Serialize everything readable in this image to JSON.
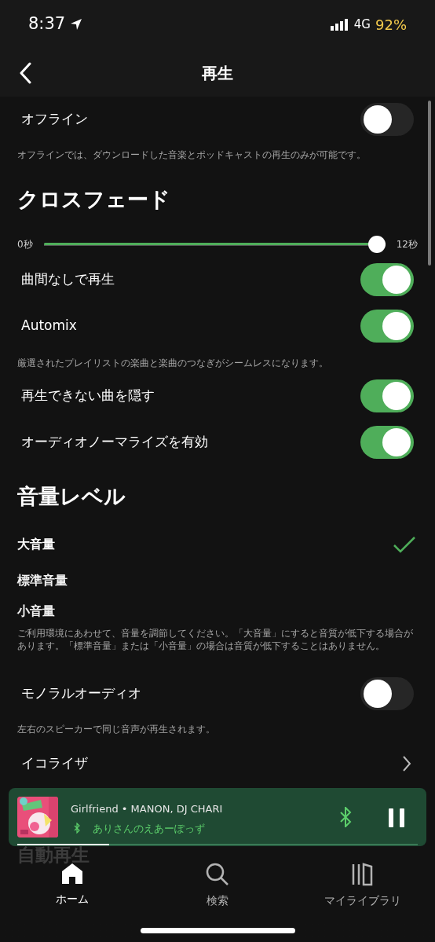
{
  "status_bar": {
    "time": "8:37",
    "network": "4G",
    "battery": "92%"
  },
  "nav": {
    "title": "再生"
  },
  "settings": [
    {
      "kind": "toggle",
      "label": "オフライン",
      "on": false
    },
    {
      "kind": "description",
      "text": "オフラインでは、ダウンロードした音楽とポッドキャストの再生のみが可能です。"
    },
    {
      "kind": "heading",
      "text": "クロスフェード"
    },
    {
      "kind": "slider",
      "min_label": "0秒",
      "max_label": "12秒",
      "level": 1
    },
    {
      "kind": "toggle",
      "label": "曲間なしで再生",
      "on": true
    },
    {
      "kind": "toggle",
      "label": "Automix",
      "on": true
    },
    {
      "kind": "description",
      "text": "厳選されたプレイリストの楽曲と楽曲のつなぎがシームレスになります。"
    },
    {
      "kind": "toggle",
      "label": "再生できない曲を隠す",
      "on": true
    },
    {
      "kind": "toggle",
      "label": "オーディオノーマライズを有効",
      "on": true
    },
    {
      "kind": "heading",
      "text": "音量レベル"
    },
    {
      "kind": "option",
      "label": "大音量",
      "selected": true
    },
    {
      "kind": "option",
      "label": "標準音量",
      "selected": false
    },
    {
      "kind": "option",
      "label": "小音量",
      "selected": false
    },
    {
      "kind": "description",
      "text": "ご利用環境にあわせて、音量を調節してください。「大音量」にすると音質が低下する場合があります。「標準音量」または「小音量」の場合は音質が低下することはありません。"
    },
    {
      "kind": "toggle",
      "label": "モノラルオーディオ",
      "on": false
    },
    {
      "kind": "description",
      "text": "左右のスピーカーで同じ音声が再生されます。"
    },
    {
      "kind": "link",
      "label": "イコライザ"
    },
    {
      "kind": "faded_heading",
      "text": "自動再生"
    }
  ],
  "now_playing": {
    "track": "Girlfriend • MANON, DJ CHARI",
    "device": "ありさんのえあーぽっず",
    "level": 0.23
  },
  "tabs": [
    {
      "label": "ホーム",
      "selected": true
    },
    {
      "label": "検索",
      "selected": false
    },
    {
      "label": "マイライブラリ",
      "selected": false
    }
  ]
}
